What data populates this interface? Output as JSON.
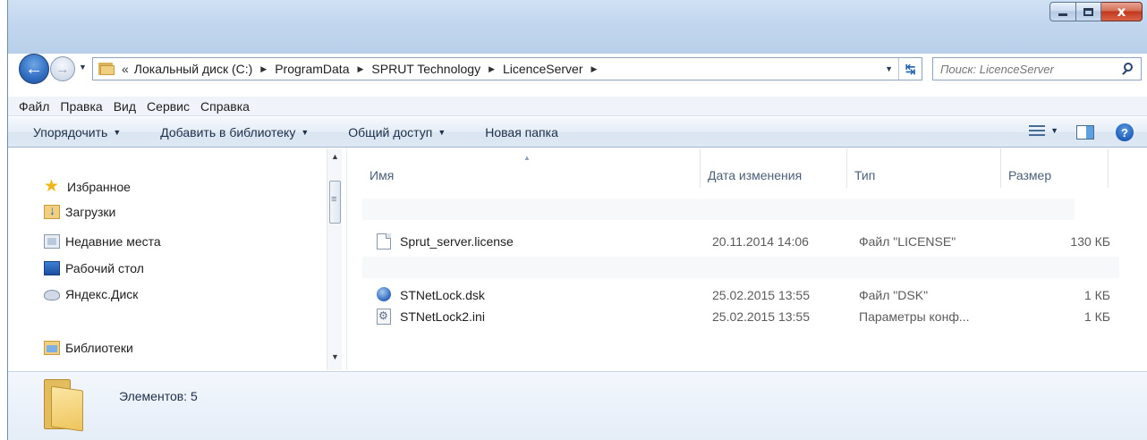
{
  "window": {
    "caption_buttons": {
      "minimize": "minimize",
      "maximize": "maximize",
      "close": "x"
    }
  },
  "navigation": {
    "overflow": "«",
    "breadcrumbs": [
      "Локальный диск (C:)",
      "ProgramData",
      "SPRUT Technology",
      "LicenceServer"
    ],
    "search_placeholder": "Поиск: LicenceServer"
  },
  "menu": [
    "Файл",
    "Правка",
    "Вид",
    "Сервис",
    "Справка"
  ],
  "toolbar": {
    "organize": "Упорядочить",
    "add_to_library": "Добавить в библиотеку",
    "share": "Общий доступ",
    "new_folder": "Новая папка"
  },
  "nav_pane": {
    "favorites": "Избранное",
    "downloads": "Загрузки",
    "recent": "Недавние места",
    "desktop": "Рабочий стол",
    "yandex_disk": "Яндекс.Диск",
    "libraries": "Библиотеки"
  },
  "columns": {
    "name": "Имя",
    "date": "Дата изменения",
    "type": "Тип",
    "size": "Размер"
  },
  "files": [
    {
      "name": "Sprut_server.license",
      "date": "20.11.2014 14:06",
      "type": "Файл \"LICENSE\"",
      "size": "130 КБ",
      "icon": "license-file-icon"
    },
    {
      "name": "STNetLock.dsk",
      "date": "25.02.2015 13:55",
      "type": "Файл \"DSK\"",
      "size": "1 КБ",
      "icon": "dsk-file-icon"
    },
    {
      "name": "STNetLock2.ini",
      "date": "25.02.2015 13:55",
      "type": "Параметры конф...",
      "size": "1 КБ",
      "icon": "ini-file-icon"
    }
  ],
  "details": {
    "items_count": "Элементов: 5"
  }
}
